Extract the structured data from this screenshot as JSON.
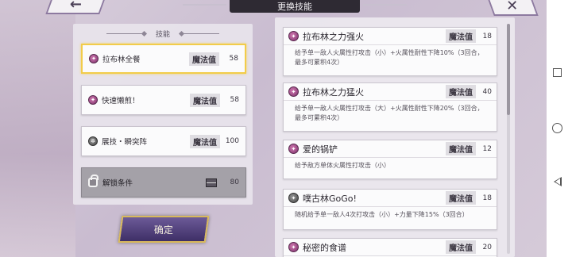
{
  "header": {
    "title": "更换技能",
    "back_glyph": "←",
    "close_glyph": "✕"
  },
  "left_panel": {
    "heading": "技能",
    "skills": [
      {
        "name": "拉布林全餐",
        "mana_label": "魔法值",
        "mana": "58",
        "icon": "magic-orb-icon"
      },
      {
        "name": "快速懒煎！",
        "mana_label": "魔法值",
        "mana": "58",
        "icon": "magic-orb-icon"
      },
      {
        "name": "展技・瞬突阵",
        "mana_label": "魔法值",
        "mana": "100",
        "icon": "gear-icon"
      }
    ],
    "unlock": {
      "label": "解锁条件",
      "value": "80"
    }
  },
  "confirm_label": "确定",
  "skill_list": [
    {
      "name": "拉布林之力强火",
      "mana_label": "魔法值",
      "mana": "18",
      "desc": "给予单一敌人火属性打攻击（小）+火属性耐性下降10%（3回合，最多可累积4次）"
    },
    {
      "name": "拉布林之力猛火",
      "mana_label": "魔法值",
      "mana": "40",
      "desc": "给予单一敌人火属性打攻击（大）+火属性耐性下降20%（3回合，最多可累积4次）"
    },
    {
      "name": "爱的锅铲",
      "mana_label": "魔法值",
      "mana": "12",
      "desc": "给予敌方单体火属性打攻击（小）"
    },
    {
      "name": "噗古林GoGo!",
      "mana_label": "魔法值",
      "mana": "18",
      "desc": "随机给予单一敌人4次打攻击（小）+力量下降15%（3回合）"
    },
    {
      "name": "秘密的食谱",
      "mana_label": "魔法值",
      "mana": "20",
      "desc": ""
    }
  ]
}
